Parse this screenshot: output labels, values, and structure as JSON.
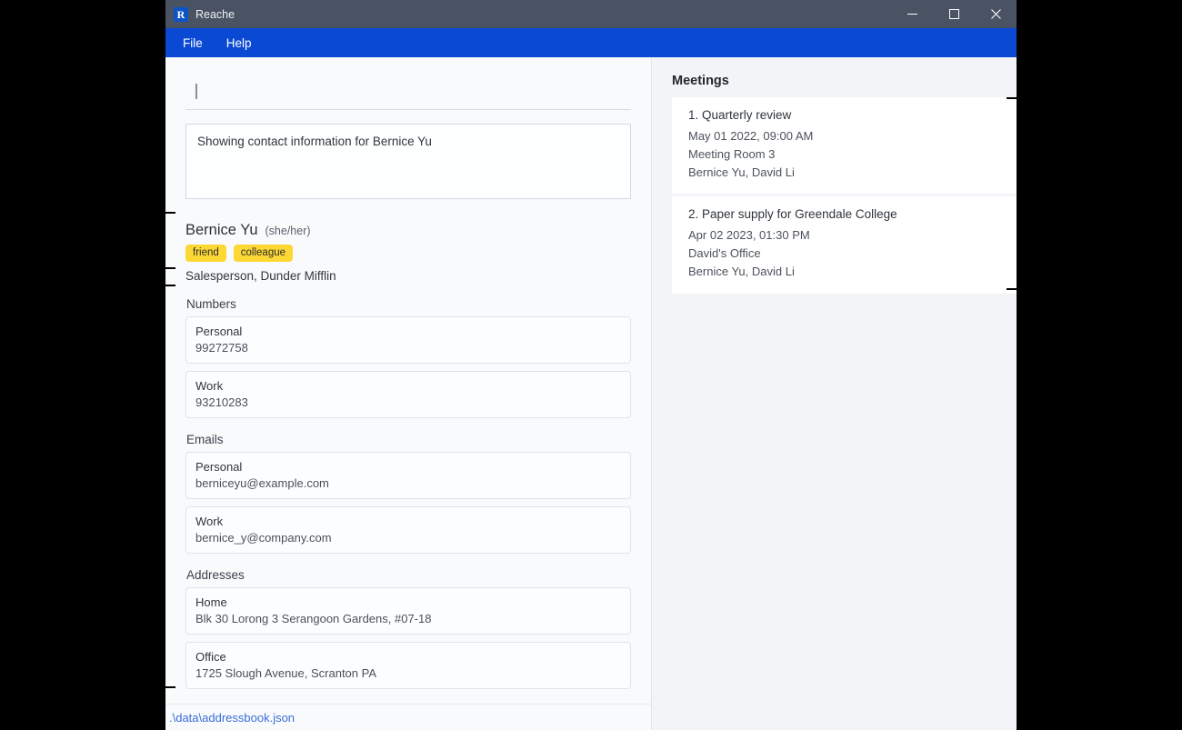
{
  "window": {
    "app_icon_letter": "R",
    "title": "Reache",
    "controls": {
      "minimize": "minimize-icon",
      "maximize": "maximize-icon",
      "close": "close-icon"
    }
  },
  "menubar": {
    "items": [
      {
        "label": "File"
      },
      {
        "label": "Help"
      }
    ]
  },
  "command": {
    "value": "",
    "placeholder": ""
  },
  "result": {
    "text": "Showing contact information for Bernice Yu"
  },
  "contact": {
    "name": "Bernice Yu",
    "pronouns": "(she/her)",
    "tags": [
      "friend",
      "colleague"
    ],
    "role": "Salesperson, Dunder Mifflin",
    "sections": [
      {
        "title": "Numbers",
        "items": [
          {
            "label": "Personal",
            "value": "99272758"
          },
          {
            "label": "Work",
            "value": "93210283"
          }
        ]
      },
      {
        "title": "Emails",
        "items": [
          {
            "label": "Personal",
            "value": "berniceyu@example.com"
          },
          {
            "label": "Work",
            "value": "bernice_y@company.com"
          }
        ]
      },
      {
        "title": "Addresses",
        "items": [
          {
            "label": "Home",
            "value": "Blk 30 Lorong 3 Serangoon Gardens, #07-18"
          },
          {
            "label": "Office",
            "value": "1725 Slough Avenue, Scranton PA"
          }
        ]
      }
    ]
  },
  "statusbar": {
    "path": ".\\data\\addressbook.json"
  },
  "meetings_panel": {
    "header": "Meetings",
    "items": [
      {
        "title": "1. Quarterly review",
        "datetime": "May 01 2022, 09:00 AM",
        "location": "Meeting Room 3",
        "attendees": "Bernice Yu, David Li"
      },
      {
        "title": "2. Paper supply for Greendale College",
        "datetime": "Apr 02 2023, 01:30 PM",
        "location": "David's Office",
        "attendees": "Bernice Yu, David Li"
      }
    ]
  },
  "colors": {
    "titlebar": "#4a5363",
    "menubar": "#0a49d4",
    "accent": "#0c53c6",
    "tag": "#fdd835",
    "link": "#3b6ddb"
  }
}
